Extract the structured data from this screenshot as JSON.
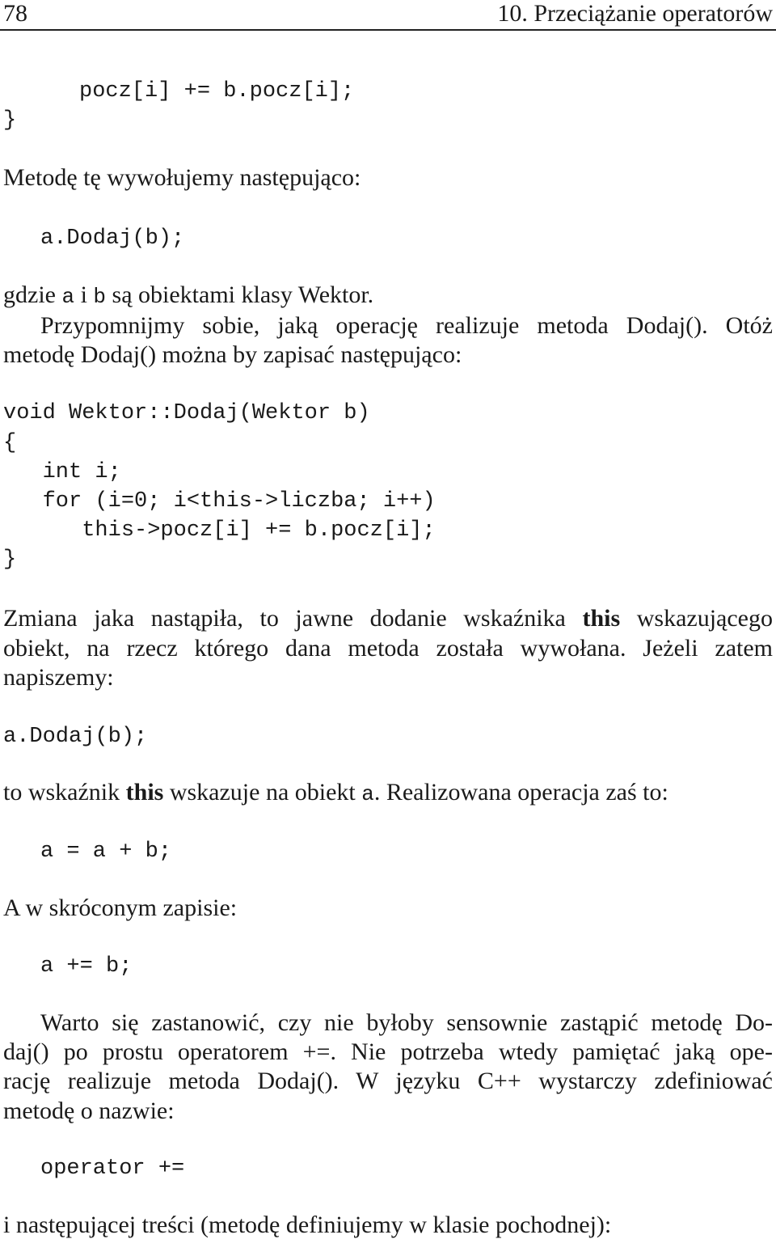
{
  "header": {
    "page_number": "78",
    "chapter_title": "10. Przeciążanie operatorów"
  },
  "code_top": {
    "line1": "pocz[i] += b.pocz[i];",
    "line2": "}"
  },
  "para1": "Metodę tę wywołujemy następująco:",
  "code_call1": "a.Dodaj(b);",
  "para2": {
    "pre": "gdzie ",
    "a": "a",
    "mid": " i ",
    "b": "b",
    "post": " są obiektami klasy Wektor."
  },
  "para3": {
    "line1": "Przypomnijmy sobie, jaką operację realizuje metoda Dodaj(). Otóż",
    "line2": "metodę Dodaj() można by zapisać następująco:"
  },
  "code_dodaj": {
    "lines": [
      "void Wektor::Dodaj(Wektor b)",
      "{",
      "   int i;",
      "   for (i=0; i<this->liczba; i++)",
      "      this->pocz[i] += b.pocz[i];",
      "}"
    ]
  },
  "para4": {
    "line1_pre": "Zmiana jaka nastąpiła, to jawne dodanie wskaźnika ",
    "line1_bold": "this",
    "line1_post": " wskazującego",
    "line2": "obiekt, na rzecz którego dana metoda została wywołana. Jeżeli zatem",
    "line3": "napiszemy:"
  },
  "code_call2": "a.Dodaj(b);",
  "para5": {
    "pre": "to wskaźnik ",
    "bold": "this",
    "mid": " wskazuje na obiekt ",
    "code": "a",
    "post": ". Realizowana operacja zaś to:"
  },
  "code_assign": "a = a + b;",
  "para6": "A w skróconym zapisie:",
  "code_short": "a += b;",
  "para7": {
    "line1": "Warto się zastanowić, czy nie byłoby sensownie zastąpić metodę Do-",
    "line2": "daj() po prostu operatorem +=. Nie potrzeba wtedy pamiętać jaką ope-",
    "line3": "rację realizuje metoda Dodaj(). W języku C++ wystarczy zdefiniować",
    "line4": "metodę o nazwie:"
  },
  "code_operator": "operator +=",
  "para8": "i następującej treści (metodę definiujemy w klasie pochodnej):"
}
